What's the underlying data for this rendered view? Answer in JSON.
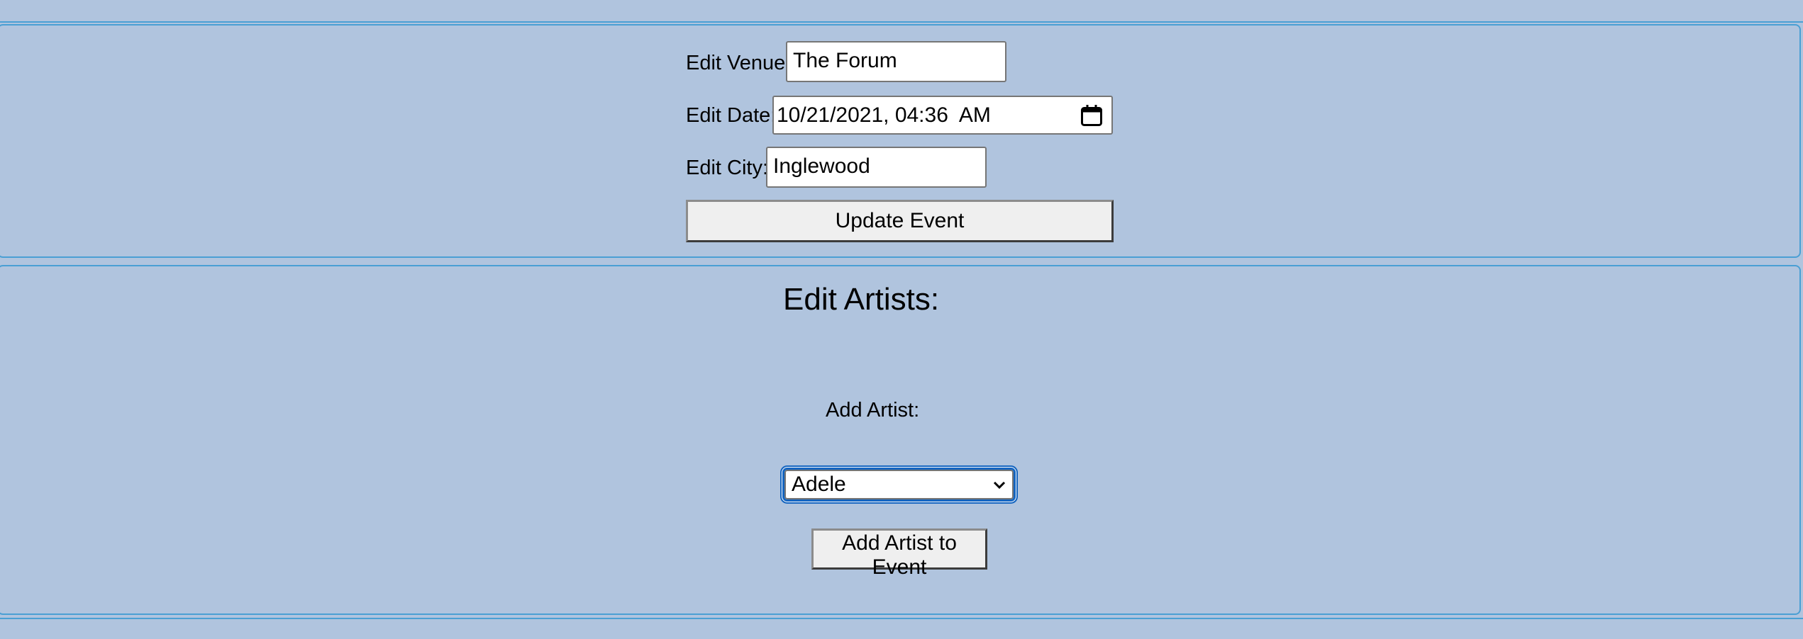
{
  "form": {
    "venue": {
      "label": "Edit Venue:",
      "value": "The Forum"
    },
    "date": {
      "label": "Edit Date:",
      "value": "10/21/2021, 04:36  AM"
    },
    "city": {
      "label": "Edit City:",
      "value": "Inglewood"
    },
    "update_button": "Update Event"
  },
  "artists": {
    "heading": "Edit Artists:",
    "add_label": "Add Artist:",
    "selected": "Adele",
    "add_button": "Add Artist to Event"
  },
  "icons": {
    "date_picker": "calendar-icon",
    "select": "chevron-down-icon"
  },
  "colors": {
    "background": "#b0c4de",
    "border": "#4a9fd4",
    "focus": "#1565c0"
  }
}
